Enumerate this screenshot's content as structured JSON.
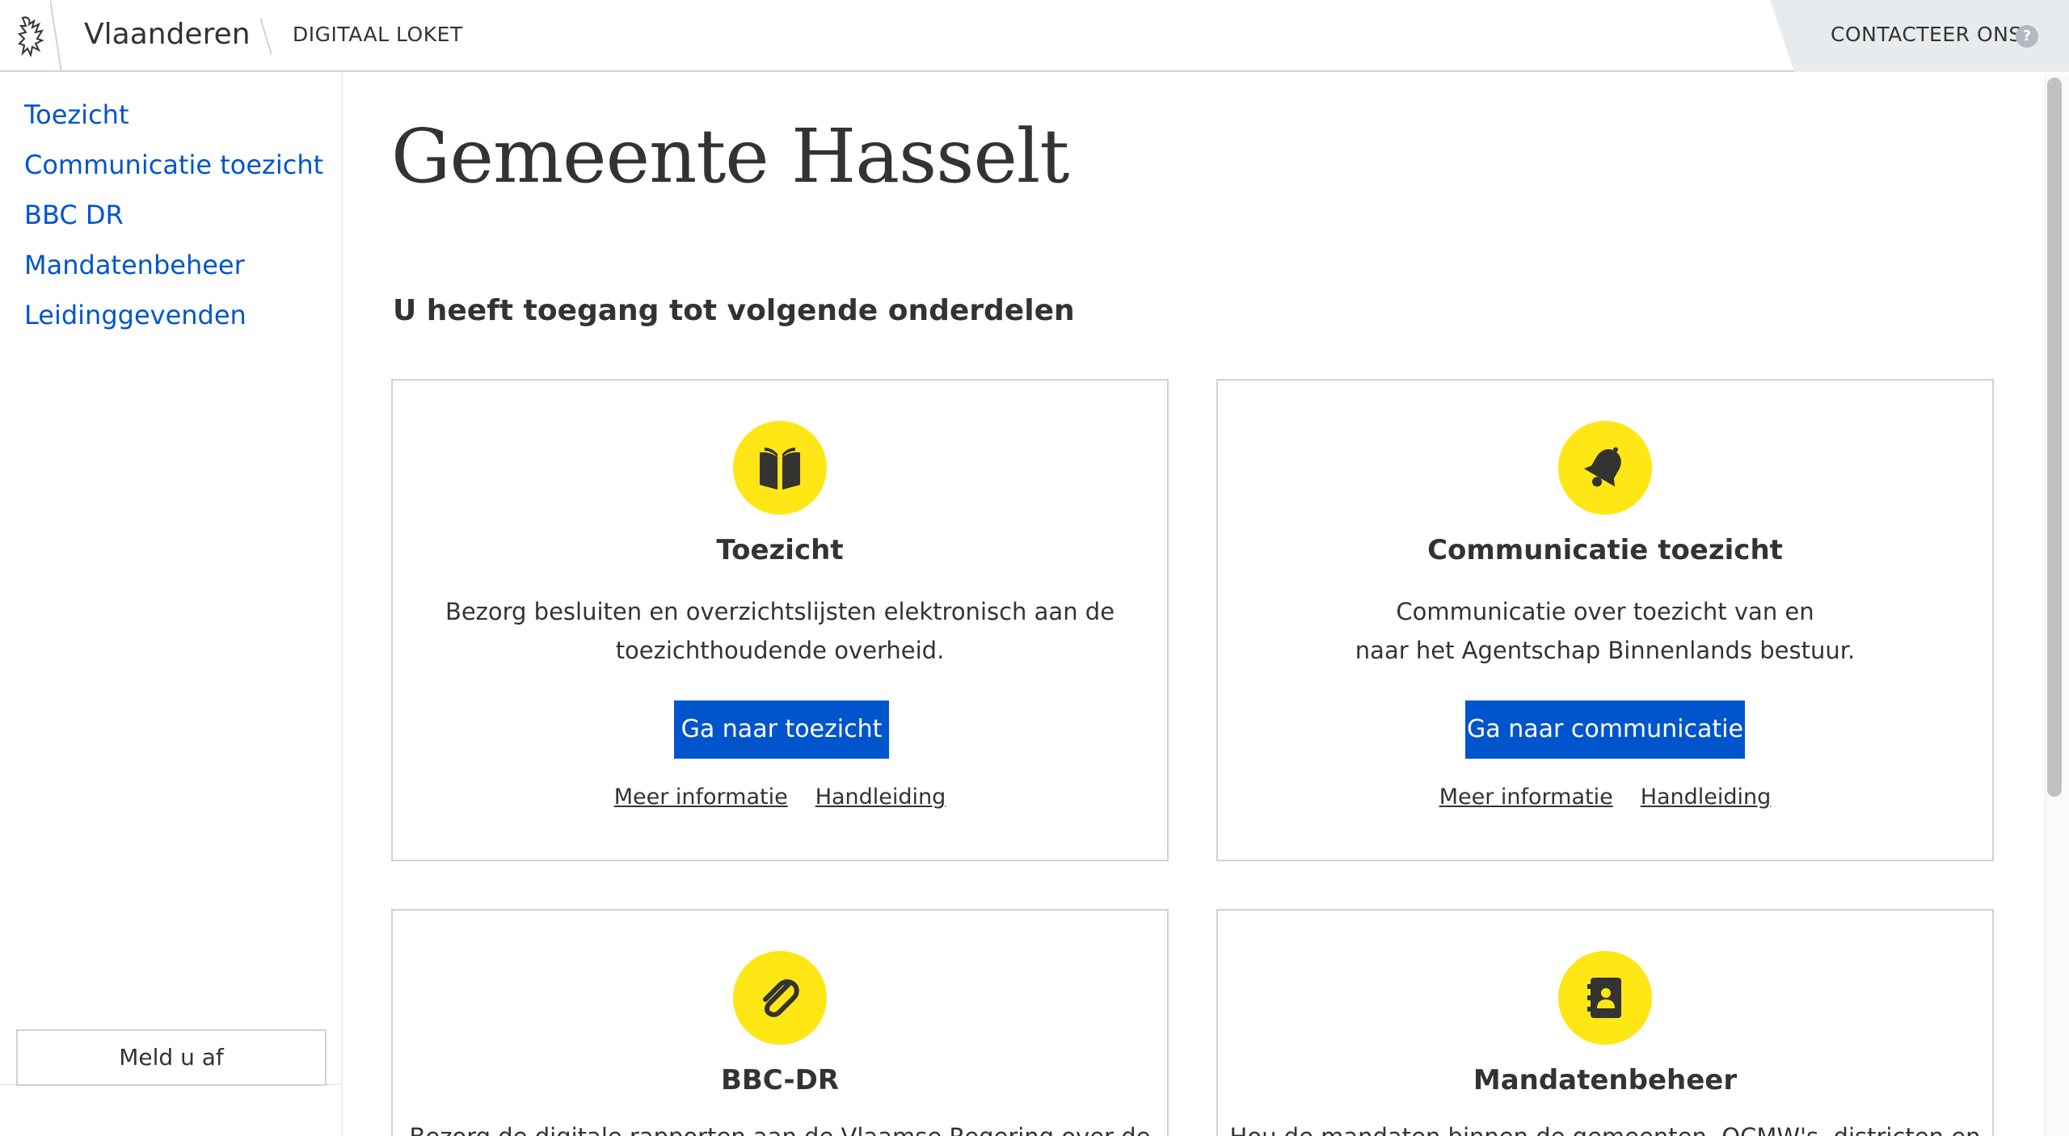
{
  "header": {
    "brand": "Vlaanderen",
    "section": "DIGITAAL LOKET",
    "contact": "CONTACTEER ONS",
    "help_glyph": "?"
  },
  "sidebar": {
    "items": [
      {
        "label": "Toezicht"
      },
      {
        "label": "Communicatie toezicht"
      },
      {
        "label": "BBC DR"
      },
      {
        "label": "Mandatenbeheer"
      },
      {
        "label": "Leidinggevenden"
      }
    ],
    "logout": "Meld u af"
  },
  "main": {
    "title": "Gemeente Hasselt",
    "subtitle": "U heeft toegang tot volgende onderdelen",
    "cards": [
      {
        "icon": "book-icon",
        "title": "Toezicht",
        "desc_lines": [
          "Bezorg besluiten en overzichtslijsten elektronisch aan de",
          "toezichthoudende overheid."
        ],
        "button": "Ga naar toezicht",
        "link_info": "Meer informatie",
        "link_manual": "Handleiding"
      },
      {
        "icon": "bell-icon",
        "title": "Communicatie toezicht",
        "desc_lines": [
          "Communicatie over toezicht van en",
          "naar het Agentschap Binnenlands bestuur."
        ],
        "button": "Ga naar communicatie",
        "link_info": "Meer informatie",
        "link_manual": "Handleiding"
      },
      {
        "icon": "paperclip-icon",
        "title": "BBC-DR",
        "desc_lines": [
          "Bezorg de digitale rapporten aan de Vlaamse Regering over de"
        ]
      },
      {
        "icon": "address-book-icon",
        "title": "Mandatenbeheer",
        "desc_lines": [
          "Hou de mandaten binnen de gemeenten, OCMW's, districten en"
        ]
      }
    ]
  },
  "colors": {
    "accent": "#0055cc",
    "icon_bg": "#ffe615",
    "text": "#333332",
    "border": "#cbd2da"
  }
}
